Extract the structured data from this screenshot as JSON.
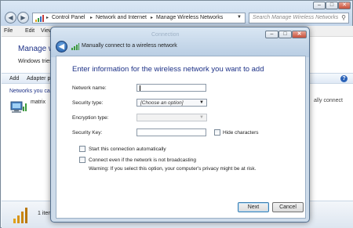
{
  "background": {
    "address": {
      "crumbs": [
        "Control Panel",
        "Network and Internet",
        "Manage Wireless Networks"
      ],
      "separator": "▸"
    },
    "search_placeholder": "Search Manage Wireless Networks",
    "menu": [
      "File",
      "Edit",
      "View"
    ],
    "heading": "Manage wire",
    "subtext": "Windows tries to",
    "toolbar": [
      "Add",
      "Adapter pro"
    ],
    "networks_label": "Networks you can vi",
    "network_name": "matrix",
    "manual_connect": "ally connect",
    "status_count": "1 item"
  },
  "dialog": {
    "title": "Manually connect to a wireless network",
    "ghost_title": "Connection",
    "heading": "Enter information for the wireless network you want to add",
    "fields": {
      "network_name_label": "Network name:",
      "network_name_value": "",
      "security_type_label": "Security type:",
      "security_type_value": "[Choose an option]",
      "encryption_type_label": "Encryption type:",
      "encryption_type_value": "",
      "security_key_label": "Security Key:",
      "security_key_value": "",
      "hide_characters_label": "Hide characters"
    },
    "options": {
      "start_auto_label": "Start this connection automatically",
      "connect_broadcast_label": "Connect even if the network is not broadcasting",
      "warning": "Warning: If you select this option, your computer's privacy might be at risk."
    },
    "buttons": {
      "next": "Next",
      "cancel": "Cancel"
    }
  },
  "colors": {
    "heading_blue": "#1e3287",
    "frame_blue": "#cddbea",
    "close_red": "#c7503b"
  },
  "icons": [
    "back-arrow-icon",
    "forward-arrow-icon",
    "search-icon",
    "refresh-icon",
    "help-icon",
    "wireless-signal-icon",
    "network-computer-icon",
    "close-icon",
    "minimize-icon",
    "maximize-icon",
    "dropdown-arrow-icon"
  ]
}
